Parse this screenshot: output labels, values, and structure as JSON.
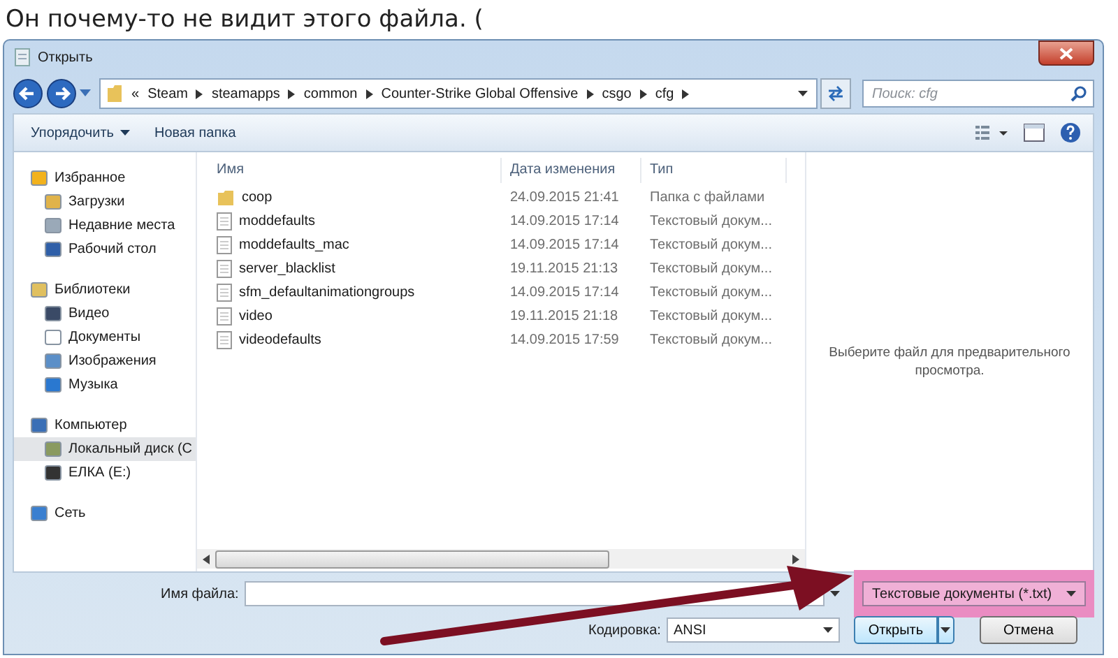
{
  "caption": "Он почему-то не видит этого файла. (",
  "window": {
    "title": "Открыть"
  },
  "address": {
    "overflow_mark": "«",
    "path": [
      "Steam",
      "steamapps",
      "common",
      "Counter-Strike Global Offensive",
      "csgo",
      "cfg"
    ]
  },
  "search": {
    "placeholder": "Поиск: cfg"
  },
  "toolbar": {
    "organize": "Упорядочить",
    "new_folder": "Новая папка"
  },
  "sidebar": [
    {
      "label": "Избранное",
      "selected": false,
      "children": [
        {
          "label": "Загрузки",
          "selected": false
        },
        {
          "label": "Недавние места",
          "selected": false
        },
        {
          "label": "Рабочий стол",
          "selected": false
        }
      ]
    },
    {
      "label": "Библиотеки",
      "selected": false,
      "children": [
        {
          "label": "Видео",
          "selected": false
        },
        {
          "label": "Документы",
          "selected": false
        },
        {
          "label": "Изображения",
          "selected": false
        },
        {
          "label": "Музыка",
          "selected": false
        }
      ]
    },
    {
      "label": "Компьютер",
      "selected": false,
      "children": [
        {
          "label": "Локальный диск (С",
          "selected": true
        },
        {
          "label": "ЕЛКА (E:)",
          "selected": false
        }
      ]
    },
    {
      "label": "Сеть",
      "selected": false
    }
  ],
  "columns": [
    "Имя",
    "Дата изменения",
    "Тип"
  ],
  "files": [
    {
      "name": "coop",
      "date": "24.09.2015 21:41",
      "type": "Папка с файлами",
      "kind": "folder"
    },
    {
      "name": "moddefaults",
      "date": "14.09.2015 17:14",
      "type": "Текстовый докум...",
      "kind": "file"
    },
    {
      "name": "moddefaults_mac",
      "date": "14.09.2015 17:14",
      "type": "Текстовый докум...",
      "kind": "file"
    },
    {
      "name": "server_blacklist",
      "date": "19.11.2015 21:13",
      "type": "Текстовый докум...",
      "kind": "file"
    },
    {
      "name": "sfm_defaultanimationgroups",
      "date": "14.09.2015 17:14",
      "type": "Текстовый докум...",
      "kind": "file"
    },
    {
      "name": "video",
      "date": "19.11.2015 21:18",
      "type": "Текстовый докум...",
      "kind": "file"
    },
    {
      "name": "videodefaults",
      "date": "14.09.2015 17:59",
      "type": "Текстовый докум...",
      "kind": "file"
    }
  ],
  "preview": "Выберите файл для предварительного просмотра.",
  "filename": {
    "label": "Имя файла:"
  },
  "filter": "Текстовые документы (*.txt)",
  "encoding": {
    "label": "Кодировка:",
    "value": "ANSI"
  },
  "buttons": {
    "open": "Открыть",
    "cancel": "Отмена"
  }
}
